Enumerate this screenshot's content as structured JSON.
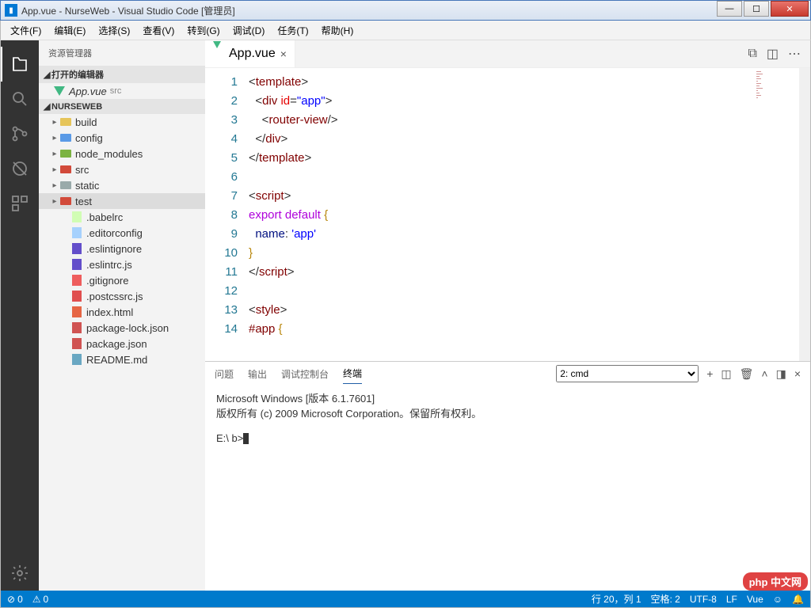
{
  "window": {
    "title": "App.vue - NurseWeb - Visual Studio Code [管理员]"
  },
  "menubar": [
    "文件(F)",
    "编辑(E)",
    "选择(S)",
    "查看(V)",
    "转到(G)",
    "调试(D)",
    "任务(T)",
    "帮助(H)"
  ],
  "sidebar": {
    "header": "资源管理器",
    "openEditors": {
      "title": "打开的编辑器",
      "items": [
        {
          "label": "App.vue",
          "sub": "src"
        }
      ]
    },
    "project": {
      "title": "NURSEWEB",
      "tree": [
        {
          "depth": 0,
          "type": "folder",
          "color": "",
          "arrow": "▸",
          "label": "build"
        },
        {
          "depth": 0,
          "type": "folder",
          "color": "blue",
          "arrow": "▸",
          "label": "config"
        },
        {
          "depth": 0,
          "type": "folder",
          "color": "green",
          "arrow": "▸",
          "label": "node_modules"
        },
        {
          "depth": 0,
          "type": "folder",
          "color": "red",
          "arrow": "▸",
          "label": "src"
        },
        {
          "depth": 0,
          "type": "folder",
          "color": "grey",
          "arrow": "▸",
          "label": "static"
        },
        {
          "depth": 0,
          "type": "folder",
          "color": "red",
          "arrow": "▸",
          "label": "test",
          "selected": true
        },
        {
          "depth": 1,
          "type": "file",
          "icon": "yaml",
          "label": ".babelrc"
        },
        {
          "depth": 1,
          "type": "file",
          "icon": "cfg",
          "label": ".editorconfig"
        },
        {
          "depth": 1,
          "type": "file",
          "icon": "eslint",
          "label": ".eslintignore"
        },
        {
          "depth": 1,
          "type": "file",
          "icon": "eslint",
          "label": ".eslintrc.js"
        },
        {
          "depth": 1,
          "type": "file",
          "icon": "git",
          "label": ".gitignore"
        },
        {
          "depth": 1,
          "type": "file",
          "icon": "postcss",
          "label": ".postcssrc.js"
        },
        {
          "depth": 1,
          "type": "file",
          "icon": "html",
          "label": "index.html"
        },
        {
          "depth": 1,
          "type": "file",
          "icon": "npm",
          "label": "package-lock.json"
        },
        {
          "depth": 1,
          "type": "file",
          "icon": "npm",
          "label": "package.json"
        },
        {
          "depth": 1,
          "type": "file",
          "icon": "md",
          "label": "README.md"
        }
      ]
    }
  },
  "tabs": {
    "items": [
      {
        "label": "App.vue"
      }
    ]
  },
  "editor": {
    "lines": [
      [
        {
          "c": "tk-punc",
          "t": "<"
        },
        {
          "c": "tk-tag",
          "t": "template"
        },
        {
          "c": "tk-punc",
          "t": ">"
        }
      ],
      [
        {
          "c": "tk-text",
          "t": "  "
        },
        {
          "c": "tk-punc",
          "t": "<"
        },
        {
          "c": "tk-tag",
          "t": "div"
        },
        {
          "c": "tk-text",
          "t": " "
        },
        {
          "c": "tk-attr",
          "t": "id"
        },
        {
          "c": "tk-punc",
          "t": "="
        },
        {
          "c": "tk-str",
          "t": "\"app\""
        },
        {
          "c": "tk-punc",
          "t": ">"
        }
      ],
      [
        {
          "c": "tk-text",
          "t": "    "
        },
        {
          "c": "tk-punc",
          "t": "<"
        },
        {
          "c": "tk-tag",
          "t": "router-view"
        },
        {
          "c": "tk-punc",
          "t": "/>"
        }
      ],
      [
        {
          "c": "tk-text",
          "t": "  "
        },
        {
          "c": "tk-punc",
          "t": "</"
        },
        {
          "c": "tk-tag",
          "t": "div"
        },
        {
          "c": "tk-punc",
          "t": ">"
        }
      ],
      [
        {
          "c": "tk-punc",
          "t": "</"
        },
        {
          "c": "tk-tag",
          "t": "template"
        },
        {
          "c": "tk-punc",
          "t": ">"
        }
      ],
      [],
      [
        {
          "c": "tk-punc",
          "t": "<"
        },
        {
          "c": "tk-tag",
          "t": "script"
        },
        {
          "c": "tk-punc",
          "t": ">"
        }
      ],
      [
        {
          "c": "tk-kw2",
          "t": "export"
        },
        {
          "c": "tk-text",
          "t": " "
        },
        {
          "c": "tk-kw2",
          "t": "default"
        },
        {
          "c": "tk-text",
          "t": " "
        },
        {
          "c": "tk-brace",
          "t": "{"
        }
      ],
      [
        {
          "c": "tk-text",
          "t": "  "
        },
        {
          "c": "tk-name",
          "t": "name"
        },
        {
          "c": "tk-punc",
          "t": ": "
        },
        {
          "c": "tk-str",
          "t": "'app'"
        }
      ],
      [
        {
          "c": "tk-brace",
          "t": "}"
        }
      ],
      [
        {
          "c": "tk-punc",
          "t": "</"
        },
        {
          "c": "tk-tag",
          "t": "script"
        },
        {
          "c": "tk-punc",
          "t": ">"
        }
      ],
      [],
      [
        {
          "c": "tk-punc",
          "t": "<"
        },
        {
          "c": "tk-tag",
          "t": "style"
        },
        {
          "c": "tk-punc",
          "t": ">"
        }
      ],
      [
        {
          "c": "tk-sel",
          "t": "#app"
        },
        {
          "c": "tk-text",
          "t": " "
        },
        {
          "c": "tk-brace",
          "t": "{"
        }
      ]
    ]
  },
  "panel": {
    "tabs": [
      "问题",
      "输出",
      "调试控制台",
      "终端"
    ],
    "activeTab": 3,
    "terminalSelector": "2: cmd",
    "terminal": {
      "line1": "Microsoft Windows [版本 6.1.7601]",
      "line2": "版权所有 (c) 2009 Microsoft Corporation。保留所有权利。",
      "prompt": "E:\\                    b>"
    }
  },
  "statusbar": {
    "errors": "0",
    "warnings": "0",
    "cursor": "行 20，列 1",
    "spaces": "空格: 2",
    "encoding": "UTF-8",
    "eol": "LF",
    "lang": "Vue"
  },
  "watermark": "php 中文网"
}
